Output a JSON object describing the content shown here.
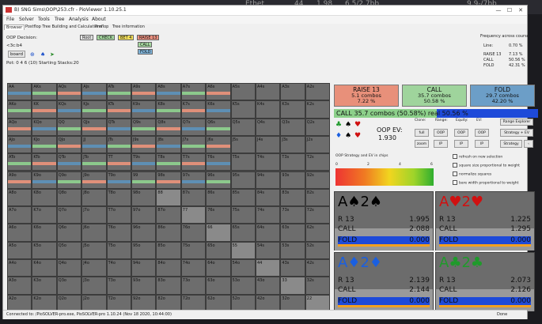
{
  "background": {
    "ghost_texts": [
      "Ethet",
      "44",
      "1.98",
      "6.5/2.7bb",
      "9.9-/7bb"
    ]
  },
  "window": {
    "title": "B) SNG Sims\\OOP\\253.cfr - PioViewer 1.10.25.1",
    "minimize": "—",
    "maximize": "☐",
    "close": "✕"
  },
  "menu": [
    "File",
    "Solver",
    "Tools",
    "Tree",
    "Analysis",
    "About"
  ],
  "tabs": [
    "Browser",
    "Postflop Tree Building and Calculations",
    "Preflop",
    "Tree information"
  ],
  "left_panel": {
    "decision": "OOP Decision:",
    "board": "<3c:b4",
    "board_button": "board",
    "pot": "Pot: 0 4 6 (10) Starting Stacks:20"
  },
  "node_buttons": {
    "root": "Root",
    "check": "CHECK",
    "bet": "BET 4",
    "raise": "RAISE 13",
    "call": "CALL",
    "fold": "FOLD"
  },
  "frequency": {
    "title": "Frequency across course:",
    "rows": [
      {
        "label": "Line:",
        "value": "0.70 %"
      },
      {
        "label": "RAISE 13",
        "value": "7.13 %"
      },
      {
        "label": "CALL",
        "value": "50.56 %"
      },
      {
        "label": "FOLD",
        "value": "42.31 %"
      }
    ]
  },
  "grid": {
    "labels": [
      [
        "AA",
        "AKs",
        "AQs",
        "AJs",
        "ATs",
        "A9s",
        "A8s",
        "A7s",
        "A6s",
        "A5s",
        "A4s",
        "A3s",
        "A2s"
      ],
      [
        "AKo",
        "KK",
        "KQs",
        "KJs",
        "KTs",
        "K9s",
        "K8s",
        "K7s",
        "K6s",
        "K5s",
        "K4s",
        "K3s",
        "K2s"
      ],
      [
        "AQo",
        "KQo",
        "QQ",
        "QJs",
        "QTs",
        "Q9s",
        "Q8s",
        "Q7s",
        "Q6s",
        "Q5s",
        "Q4s",
        "Q3s",
        "Q2s"
      ],
      [
        "AJo",
        "KJo",
        "QJo",
        "JJ",
        "JTs",
        "J9s",
        "J8s",
        "J7s",
        "J6s",
        "J5s",
        "J4s",
        "J3s",
        "J2s"
      ],
      [
        "ATo",
        "KTo",
        "QTo",
        "JTo",
        "TT",
        "T9s",
        "T8s",
        "T7s",
        "T6s",
        "T5s",
        "T4s",
        "T3s",
        "T2s"
      ],
      [
        "A9o",
        "K9o",
        "Q9o",
        "J9o",
        "T9o",
        "99",
        "98s",
        "97s",
        "96s",
        "95s",
        "94s",
        "93s",
        "92s"
      ],
      [
        "A8o",
        "K8o",
        "Q8o",
        "J8o",
        "T8o",
        "98o",
        "88",
        "87s",
        "86s",
        "85s",
        "84s",
        "83s",
        "82s"
      ],
      [
        "A7o",
        "K7o",
        "Q7o",
        "J7o",
        "T7o",
        "97o",
        "87o",
        "77",
        "76s",
        "75s",
        "74s",
        "73s",
        "72s"
      ],
      [
        "A6o",
        "K6o",
        "Q6o",
        "J6o",
        "T6o",
        "96o",
        "86o",
        "76o",
        "66",
        "65s",
        "64s",
        "63s",
        "62s"
      ],
      [
        "A5o",
        "K5o",
        "Q5o",
        "J5o",
        "T5o",
        "95o",
        "85o",
        "75o",
        "65o",
        "55",
        "54s",
        "53s",
        "52s"
      ],
      [
        "A4o",
        "K4o",
        "Q4o",
        "J4o",
        "T4o",
        "94o",
        "84o",
        "74o",
        "64o",
        "54o",
        "44",
        "43s",
        "42s"
      ],
      [
        "A3o",
        "K3o",
        "Q3o",
        "J3o",
        "T3o",
        "93o",
        "83o",
        "73o",
        "63o",
        "53o",
        "43o",
        "33",
        "32s"
      ],
      [
        "A2o",
        "K2o",
        "Q2o",
        "J2o",
        "T2o",
        "92o",
        "82o",
        "72o",
        "62o",
        "52o",
        "42o",
        "32o",
        "22"
      ]
    ],
    "colors": {
      "raise": "#e0907a",
      "call": "#8cc98c",
      "fold": "#5e8fb4",
      "cell": "#6d6d6d"
    }
  },
  "actions": [
    {
      "name": "RAISE 13",
      "combos": "5.1 combos",
      "pct": "7.22 %",
      "color": "#e8907a"
    },
    {
      "name": "CALL",
      "combos": "35.7 combos",
      "pct": "50.58 %",
      "color": "#9fd49c"
    },
    {
      "name": "FOLD",
      "combos": "29.7 combos",
      "pct": "42.20 %",
      "color": "#6c9ec7"
    }
  ],
  "summary_bar": {
    "text": "CALL   35.7 combos (50.58%) real  50.56 %",
    "fill_fraction": 0.5058
  },
  "ev": {
    "label": "OOP EV:",
    "value": "1.930"
  },
  "controls": {
    "headers": [
      "Clone:",
      "Range:",
      "Equity:",
      "EV:"
    ],
    "row1": [
      "full",
      "OOP",
      "OOP",
      "OOP"
    ],
    "row2": [
      "zoom",
      "IP",
      "IP",
      "IP"
    ],
    "range_explorer": "Range Explorer",
    "strategy_ev": "Strategy + EV",
    "strategy": "Strategy",
    "arrow": "‹"
  },
  "checkboxes": [
    "refresh on new selection",
    "square size proportional to weight",
    "normalize squares",
    "bare width proportional to weight"
  ],
  "legend": {
    "title": "OOP Strategy and EV in chips",
    "ticks": [
      "0",
      "2",
      "4",
      "6"
    ]
  },
  "cards": [
    {
      "rank1": "A",
      "suit1": "♠",
      "rank2": "2",
      "suit2": "♠",
      "color": "#000000",
      "bg": "#6c6c6c",
      "rows": [
        {
          "label": "R 13",
          "value": "1.995"
        },
        {
          "label": "CALL",
          "value": "2.088"
        },
        {
          "label": "FOLD",
          "value": "0.000"
        }
      ]
    },
    {
      "rank1": "A",
      "suit1": "♥",
      "rank2": "2",
      "suit2": "♥",
      "color": "#d01010",
      "bg": "#6c6c6c",
      "rows": [
        {
          "label": "R 13",
          "value": "1.225"
        },
        {
          "label": "CALL",
          "value": "1.295"
        },
        {
          "label": "FOLD",
          "value": "0.000"
        }
      ]
    },
    {
      "rank1": "A",
      "suit1": "♦",
      "rank2": "2",
      "suit2": "♦",
      "color": "#1a5fe0",
      "bg": "#6c6c6c",
      "rows": [
        {
          "label": "R 13",
          "value": "2.139"
        },
        {
          "label": "CALL",
          "value": "2.144"
        },
        {
          "label": "FOLD",
          "value": "0.000"
        }
      ]
    },
    {
      "rank1": "A",
      "suit1": "♣",
      "rank2": "2",
      "suit2": "♣",
      "color": "#1f9a2b",
      "bg": "#6c6c6c",
      "rows": [
        {
          "label": "R 13",
          "value": "2.073"
        },
        {
          "label": "CALL",
          "value": "2.126"
        },
        {
          "label": "FOLD",
          "value": "0.000"
        }
      ]
    }
  ],
  "status": {
    "left": "Connected to: /PioSOLVER-pro.exe, PioSOLVER-pro 1.10.24 (Nov 18 2020, 10:44:00)",
    "right": "Done"
  }
}
